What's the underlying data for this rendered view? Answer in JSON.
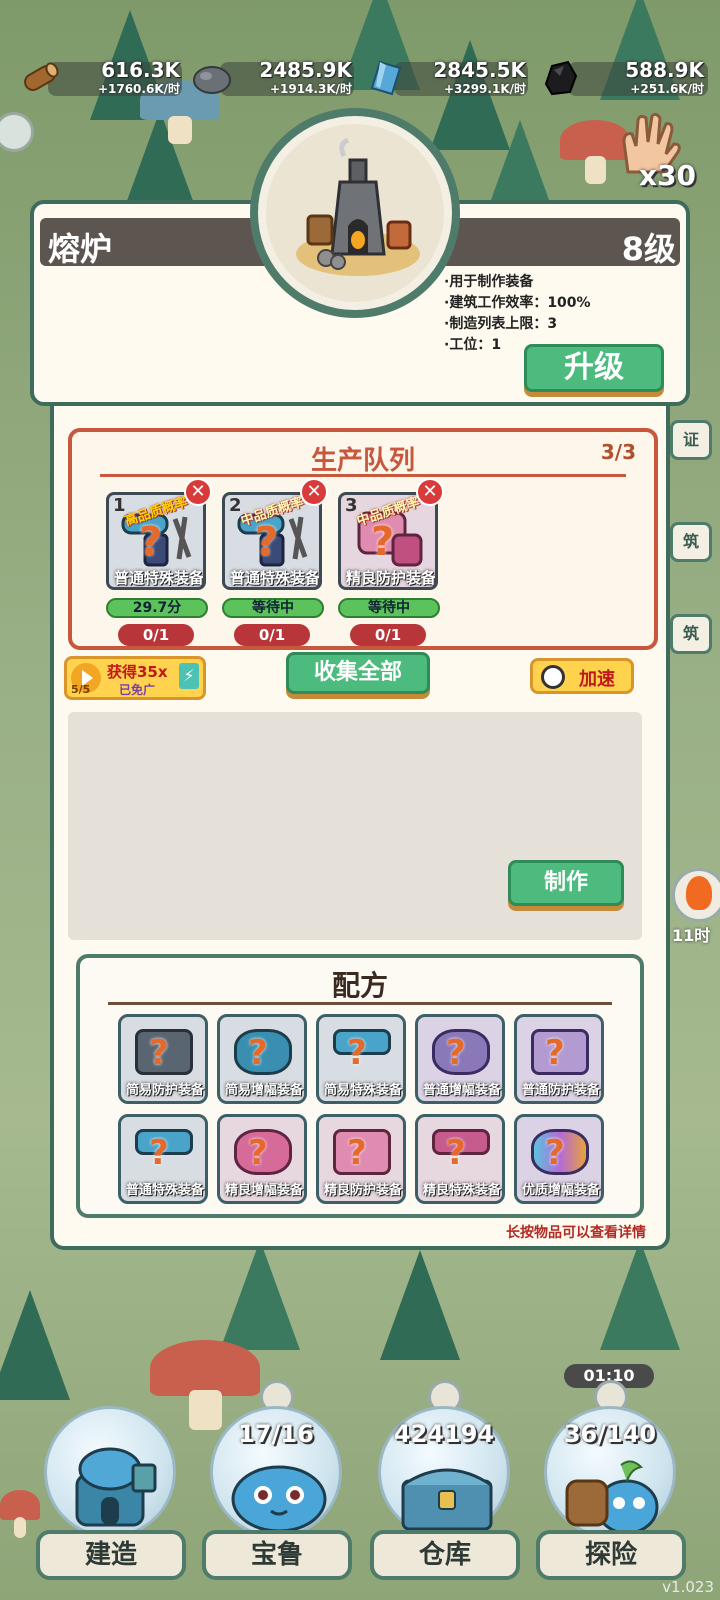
{
  "resources": [
    {
      "name": "wood-icon",
      "amount": "616.3K",
      "rate": "+1760.6K/时"
    },
    {
      "name": "stone-icon",
      "amount": "2485.9K",
      "rate": "+1914.3K/时"
    },
    {
      "name": "crystal-icon",
      "amount": "2845.5K",
      "rate": "+3299.1K/时"
    },
    {
      "name": "coal-icon",
      "amount": "588.9K",
      "rate": "+251.6K/时"
    }
  ],
  "gesture": {
    "multiplier": "x30"
  },
  "building": {
    "name": "熔炉",
    "level": "8级",
    "stats": [
      "·用于制作装备",
      "·建筑工作效率：100%",
      "·制造列表上限：3",
      "·工位：1"
    ],
    "upgrade_label": "升级"
  },
  "queue": {
    "title": "生产队列",
    "count": "3/3",
    "slots": [
      {
        "index": "1",
        "tag": "高品质概率↑",
        "label": "普通特殊装备",
        "status": "29.7分",
        "count": "0/1"
      },
      {
        "index": "2",
        "tag": "中品质概率↑",
        "label": "普通特殊装备",
        "status": "等待中",
        "count": "0/1"
      },
      {
        "index": "3",
        "tag": "中品质概率↑",
        "label": "精良防护装备",
        "status": "等待中",
        "count": "0/1"
      }
    ]
  },
  "actions": {
    "ad_count": "5/5",
    "ad_gain": "获得35x",
    "ad_free": "已免广",
    "collect_all": "收集全部",
    "speed_up": "加速",
    "make": "制作"
  },
  "recipes": {
    "title": "配方",
    "items": [
      {
        "label": "简易防护装备",
        "tone": "gray"
      },
      {
        "label": "简易增幅装备",
        "tone": "gray"
      },
      {
        "label": "简易特殊装备",
        "tone": "gray"
      },
      {
        "label": "普通增幅装备",
        "tone": "purple"
      },
      {
        "label": "普通防护装备",
        "tone": "purple"
      },
      {
        "label": "普通特殊装备",
        "tone": "gray"
      },
      {
        "label": "精良增幅装备",
        "tone": "pink"
      },
      {
        "label": "精良防护装备",
        "tone": "pink"
      },
      {
        "label": "精良特殊装备",
        "tone": "pink"
      },
      {
        "label": "优质增幅装备",
        "tone": "purple"
      }
    ],
    "hint": "长按物品可以查看详情"
  },
  "side_tabs": [
    "证",
    "筑",
    "筑"
  ],
  "fire_timer": "11时",
  "nav": [
    {
      "label": "建造",
      "counter": ""
    },
    {
      "label": "宝鲁",
      "counter": "17/16"
    },
    {
      "label": "仓库",
      "counter": "424194"
    },
    {
      "label": "探险",
      "counter": "36/140"
    }
  ],
  "explore_timer": "01:10",
  "version": "v1.023",
  "colors": {
    "accent_green": "#4cbb7d",
    "panel_border": "#3e6b5c",
    "queue_red": "#c7573d",
    "alert_red": "#d93a3a"
  }
}
